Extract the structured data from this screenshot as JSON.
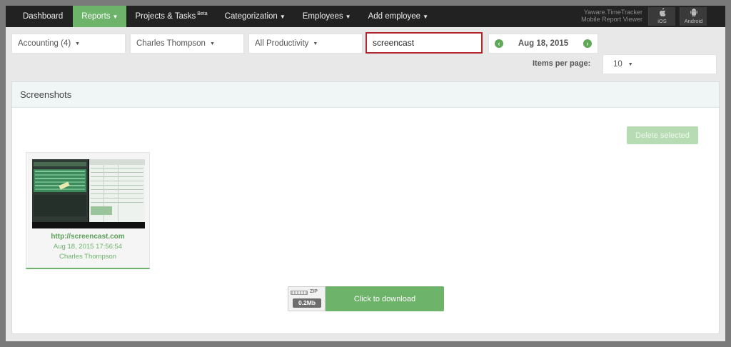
{
  "nav": {
    "items": [
      {
        "label": "Dashboard"
      },
      {
        "label": "Reports"
      },
      {
        "label": "Projects & Tasks",
        "badge": "Beta"
      },
      {
        "label": "Categorization"
      },
      {
        "label": "Employees"
      },
      {
        "label": "Add employee"
      }
    ],
    "brand_line1": "Yaware.TimeTracker",
    "brand_line2": "Mobile Report Viewer",
    "ios_label": "iOS",
    "android_label": "Android",
    "active_color": "#6db36a"
  },
  "filters": {
    "department": "Accounting (4)",
    "employee": "Charles Thompson",
    "productivity": "All Productivity",
    "search_value": "screencast",
    "date": "Aug 18, 2015",
    "items_per_page_label": "Items per page:",
    "items_per_page": "10"
  },
  "panel": {
    "title": "Screenshots",
    "delete_label": "Delete selected"
  },
  "screenshots": [
    {
      "url": "http://screencast.com",
      "datetime": "Aug 18, 2015 17:56:54",
      "employee": "Charles Thompson"
    }
  ],
  "download": {
    "zip_label": "ZIP",
    "size": "0.2Mb",
    "label": "Click to download"
  }
}
